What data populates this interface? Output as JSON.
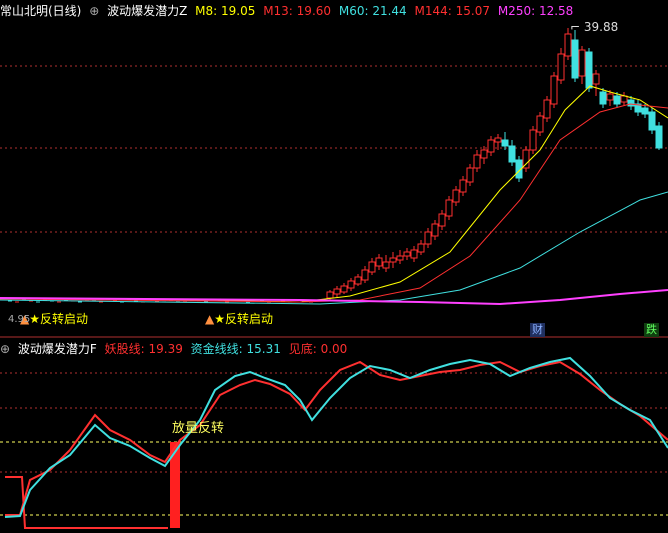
{
  "top_panel": {
    "stock_name": "常山北明(日线)",
    "indicator_name": "波动爆发潜力Z",
    "indicators": [
      {
        "label": "M8: 19.05",
        "color": "#ffff00"
      },
      {
        "label": "M13: 19.60",
        "color": "#ff3030"
      },
      {
        "label": "M60: 21.44",
        "color": "#40e0e0"
      },
      {
        "label": "M144: 15.07",
        "color": "#ff3030"
      },
      {
        "label": "M250: 12.58",
        "color": "#ff40ff"
      }
    ],
    "high_price_label": "39.88",
    "signals": [
      {
        "text": "★反转启动",
        "index": 1
      },
      {
        "text": "★反转启动",
        "index": 2
      }
    ],
    "bottom_text_left": "4.95",
    "badges": [
      {
        "text": "财",
        "color": "#4a80ff"
      },
      {
        "text": "跌",
        "color": "#40e040"
      }
    ]
  },
  "bottom_panel": {
    "indicator_name": "波动爆发潜力F",
    "indicators": [
      {
        "label": "妖股线: 19.39",
        "color": "#ff3030"
      },
      {
        "label": "资金线线: 15.31",
        "color": "#40e0e0"
      },
      {
        "label": "见底: 0.00",
        "color": "#ff3030"
      }
    ],
    "annotation": "放量反转"
  },
  "colors": {
    "up": "#ff3030",
    "down": "#40e0e0",
    "m8": "#ffff00",
    "m13": "#ff3030",
    "m60": "#40e0e0",
    "m250": "#ff40ff",
    "grid": "#b03030",
    "guide": "#ffff60"
  }
}
